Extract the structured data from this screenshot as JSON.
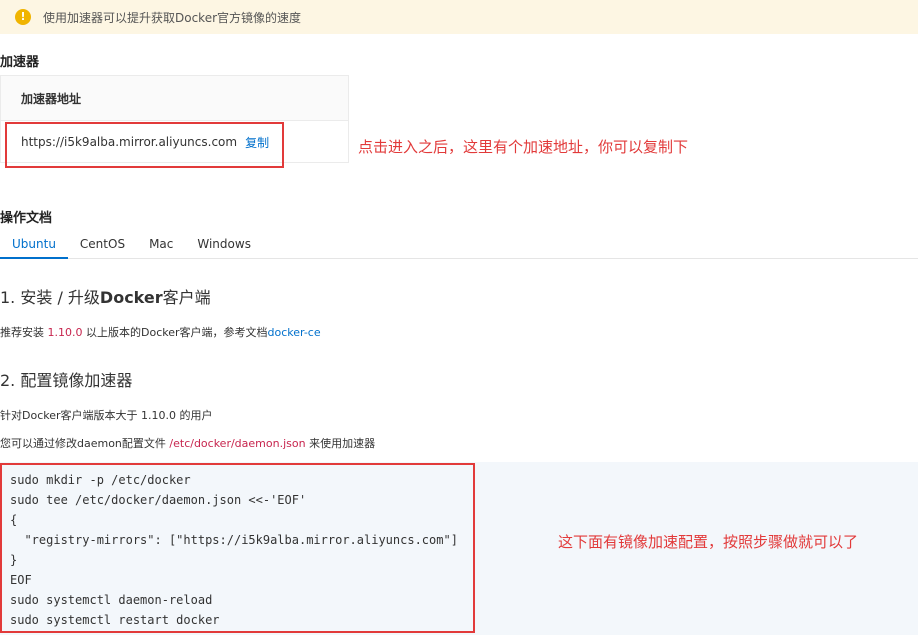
{
  "notice": {
    "icon": "warning-icon",
    "text": "使用加速器可以提升获取Docker官方镜像的速度"
  },
  "accelerator": {
    "section_title": "加速器",
    "table_header": "加速器地址",
    "address": "https://i5k9alba.mirror.aliyuncs.com",
    "copy_label": "复制"
  },
  "annotations": {
    "accel_note": "点击进入之后，这里有个加速地址，你可以复制下",
    "code_note": "这下面有镜像加速配置，按照步骤做就可以了"
  },
  "docs": {
    "section_title": "操作文档",
    "tabs": [
      "Ubuntu",
      "CentOS",
      "Mac",
      "Windows"
    ],
    "active_tab": "Ubuntu",
    "step1": {
      "heading_prefix": "1. 安装 / 升级",
      "heading_bold": "Docker",
      "heading_suffix": "客户端",
      "text_prefix": "推荐安装 ",
      "version": "1.10.0",
      "text_middle": " 以上版本的Docker客户端，参考文档",
      "link": "docker-ce"
    },
    "step2": {
      "heading": "2. 配置镜像加速器",
      "line1": "针对Docker客户端版本大于 1.10.0 的用户",
      "line2_prefix": "您可以通过修改daemon配置文件 ",
      "path": "/etc/docker/daemon.json",
      "line2_suffix": " 来使用加速器"
    },
    "code_lines": [
      "sudo mkdir -p /etc/docker",
      "sudo tee /etc/docker/daemon.json <<-'EOF'",
      "{",
      "  \"registry-mirrors\": [\"https://i5k9alba.mirror.aliyuncs.com\"]",
      "}",
      "EOF",
      "sudo systemctl daemon-reload",
      "sudo systemctl restart docker"
    ]
  },
  "colors": {
    "accent": "#0070cc",
    "annotation_red": "#e23a3a",
    "notice_bg": "#fdf6e3",
    "version_red": "#c7254e"
  }
}
